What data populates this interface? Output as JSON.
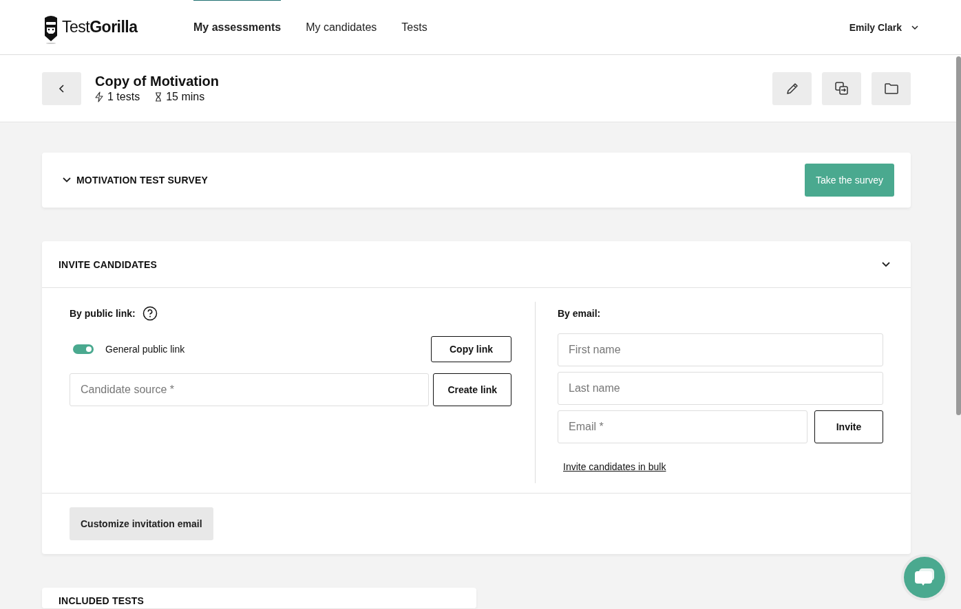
{
  "header": {
    "logo": {
      "text_light": "Test",
      "text_bold": "Gorilla"
    },
    "nav": [
      {
        "label": "My assessments",
        "selected": true
      },
      {
        "label": "My candidates",
        "selected": false
      },
      {
        "label": "Tests",
        "selected": false
      }
    ],
    "user": {
      "name": "Emily Clark"
    }
  },
  "assessment": {
    "title": "Copy of Motivation",
    "tests": "1 tests",
    "duration": "15 mins"
  },
  "survey_card": {
    "title": "MOTIVATION TEST SURVEY",
    "button": "Take the survey"
  },
  "invite": {
    "title": "INVITE CANDIDATES",
    "public_link": {
      "label": "By public link:",
      "toggle": {
        "label": "General public link",
        "on": true
      },
      "copy_button": "Copy link",
      "source_placeholder": "Candidate source *",
      "create_button": "Create link"
    },
    "email": {
      "label": "By email:",
      "first_name_placeholder": "First name",
      "last_name_placeholder": "Last name",
      "email_placeholder": "Email *",
      "invite_button": "Invite",
      "bulk_link": "Invite candidates in bulk"
    },
    "customize_button": "Customize invitation email"
  },
  "included_tests": {
    "title": "INCLUDED TESTS"
  }
}
